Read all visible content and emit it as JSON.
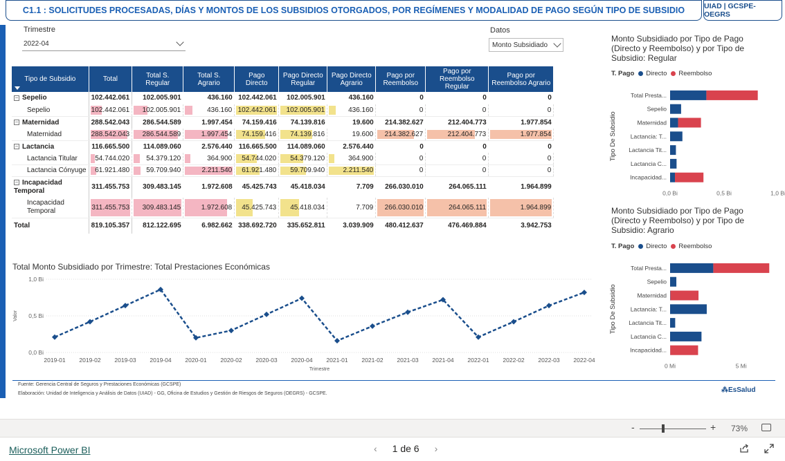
{
  "header": {
    "title": "C1.1 : SOLICITUDES PROCESADAS,  DÍAS Y MONTOS DE LOS SUBSIDIOS OTORGADOS, POR REGÍMENES Y MODALIDAD DE PAGO SEGÚN TIPO DE SUBSIDIO",
    "badge": "UIAD | GCSPE-OEGRS"
  },
  "slicers": {
    "trimestre_label": "Trimestre",
    "trimestre_value": "2022-04",
    "datos_label": "Datos",
    "datos_value": "Monto Subsidiado"
  },
  "matrix": {
    "headers": [
      "Tipo de Subsidio",
      "Total",
      "Total S. Regular",
      "Total S. Agrario",
      "Pago Directo",
      "Pago Directo Regular",
      "Pago Directo Agrario",
      "Pago por Reembolso",
      "Pago por Reembolso Regular",
      "Pago por Reembolso Agrario"
    ],
    "rows": [
      {
        "label": "Sepelio",
        "level": 0,
        "values": [
          "102.442.061",
          "102.005.901",
          "436.160",
          "102.442.061",
          "102.005.901",
          "436.160",
          "0",
          "0",
          "0"
        ]
      },
      {
        "label": "Sepelio",
        "level": 1,
        "values": [
          "102.442.061",
          "102.005.901",
          "436.160",
          "102.442.061",
          "102.005.901",
          "436.160",
          "0",
          "0",
          "0"
        ]
      },
      {
        "label": "Maternidad",
        "level": 0,
        "values": [
          "288.542.043",
          "286.544.589",
          "1.997.454",
          "74.159.416",
          "74.139.816",
          "19.600",
          "214.382.627",
          "212.404.773",
          "1.977.854"
        ]
      },
      {
        "label": "Maternidad",
        "level": 1,
        "values": [
          "288.542.043",
          "286.544.589",
          "1.997.454",
          "74.159.416",
          "74.139.816",
          "19.600",
          "214.382.627",
          "212.404.773",
          "1.977.854"
        ]
      },
      {
        "label": "Lactancia",
        "level": 0,
        "values": [
          "116.665.500",
          "114.089.060",
          "2.576.440",
          "116.665.500",
          "114.089.060",
          "2.576.440",
          "0",
          "0",
          "0"
        ]
      },
      {
        "label": "Lactancia Titular",
        "level": 1,
        "values": [
          "54.744.020",
          "54.379.120",
          "364.900",
          "54.744.020",
          "54.379.120",
          "364.900",
          "0",
          "0",
          "0"
        ]
      },
      {
        "label": "Lactancia Cónyuge",
        "level": 1,
        "values": [
          "61.921.480",
          "59.709.940",
          "2.211.540",
          "61.921.480",
          "59.709.940",
          "2.211.540",
          "0",
          "0",
          "0"
        ]
      },
      {
        "label": "Incapacidad Temporal",
        "level": 0,
        "values": [
          "311.455.753",
          "309.483.145",
          "1.972.608",
          "45.425.743",
          "45.418.034",
          "7.709",
          "266.030.010",
          "264.065.111",
          "1.964.899"
        ]
      },
      {
        "label": "Incapacidad Temporal",
        "level": 1,
        "values": [
          "311.455.753",
          "309.483.145",
          "1.972.608",
          "45.425.743",
          "45.418.034",
          "7.709",
          "266.030.010",
          "264.065.111",
          "1.964.899"
        ]
      }
    ],
    "total": {
      "label": "Total",
      "values": [
        "819.105.357",
        "812.122.695",
        "6.982.662",
        "338.692.720",
        "335.652.811",
        "3.039.909",
        "480.412.637",
        "476.469.884",
        "3.942.753"
      ]
    }
  },
  "bar_chart_regular": {
    "title": "Monto Subsidiado por Tipo de Pago (Directo y Reembolso) y por Tipo de Subsidio: Regular",
    "legend_title": "T. Pago",
    "legend_directo": "Directo",
    "legend_reembolso": "Reembolso",
    "ylabel": "Tipo De Subsidio",
    "xticks": [
      "0,0 Bi",
      "0,5 Bi",
      "1,0 Bi"
    ]
  },
  "bar_chart_agrario": {
    "title": "Monto Subsidiado por Tipo de Pago (Directo y Reembolso) y por Tipo de Subsidio: Agrario",
    "legend_title": "T. Pago",
    "legend_directo": "Directo",
    "legend_reembolso": "Reembolso",
    "ylabel": "Tipo De Subsidio",
    "xticks": [
      "0 Mi",
      "5 Mi"
    ]
  },
  "line_chart": {
    "title": "Total Monto Subsidiado por Trimestre: Total Prestaciones Económicas",
    "ylabel": "Valor",
    "xlabel": "Trimestre",
    "yticks": [
      "0,0 Bi",
      "0,5 Bi",
      "1,0 Bi"
    ]
  },
  "chart_data": [
    {
      "type": "bar",
      "orientation": "horizontal",
      "stacked": true,
      "title": "Monto Subsidiado por Tipo de Pago (Directo y Reembolso) y por Tipo de Subsidio: Regular",
      "categories": [
        "Total Presta...",
        "Sepelio",
        "Maternidad",
        "Lactancia: T...",
        "Lactancia Tit...",
        "Lactancia C...",
        "Incapacidad..."
      ],
      "series": [
        {
          "name": "Directo",
          "color": "#1a4e8c",
          "values": [
            0.336,
            0.102,
            0.074,
            0.114,
            0.054,
            0.06,
            0.045
          ]
        },
        {
          "name": "Reembolso",
          "color": "#d9434e",
          "values": [
            0.476,
            0,
            0.212,
            0,
            0,
            0,
            0.264
          ]
        }
      ],
      "xlabel": "",
      "ylabel": "Tipo De Subsidio",
      "xlim": [
        0,
        1.0
      ],
      "unit": "Bi"
    },
    {
      "type": "bar",
      "orientation": "horizontal",
      "stacked": true,
      "title": "Monto Subsidiado por Tipo de Pago (Directo y Reembolso) y por Tipo de Subsidio: Agrario",
      "categories": [
        "Total Presta...",
        "Sepelio",
        "Maternidad",
        "Lactancia: T...",
        "Lactancia Tit...",
        "Lactancia C...",
        "Incapacidad..."
      ],
      "series": [
        {
          "name": "Directo",
          "color": "#1a4e8c",
          "values": [
            3.04,
            0.44,
            0.02,
            2.58,
            0.36,
            2.21,
            0.01
          ]
        },
        {
          "name": "Reembolso",
          "color": "#d9434e",
          "values": [
            3.94,
            0,
            1.98,
            0,
            0,
            0,
            1.96
          ]
        }
      ],
      "xlabel": "",
      "ylabel": "Tipo De Subsidio",
      "xlim": [
        0,
        7.6
      ],
      "unit": "Mi"
    },
    {
      "type": "line",
      "title": "Total Monto Subsidiado por Trimestre: Total Prestaciones Económicas",
      "x": [
        "2019-01",
        "2019-02",
        "2019-03",
        "2019-04",
        "2020-01",
        "2020-02",
        "2020-03",
        "2020-04",
        "2021-01",
        "2021-02",
        "2021-03",
        "2021-04",
        "2022-01",
        "2022-02",
        "2022-03",
        "2022-04"
      ],
      "series": [
        {
          "color": "#1a4e8c",
          "values": [
            0.21,
            0.42,
            0.64,
            0.86,
            0.2,
            0.3,
            0.52,
            0.74,
            0.16,
            0.36,
            0.55,
            0.72,
            0.21,
            0.42,
            0.64,
            0.82
          ]
        }
      ],
      "xlabel": "Trimestre",
      "ylabel": "Valor",
      "ylim": [
        0,
        1.0
      ],
      "unit": "Bi",
      "style": "dashed"
    }
  ],
  "footer": {
    "fuente": "Fuente: Gerencia Central de Seguros y Prestaciones Económicas (GCSPE)",
    "elaboracion": "Elaboración: Unidad de Inteligencia y Análisis de Datos (UIAD) - GG, Oficina de Estudios y Gestión de Riesgos de Seguros (OEGRS) - GCSPE.",
    "logo": "EsSalud"
  },
  "zoom": {
    "minus": "-",
    "plus": "+",
    "percent": "73%"
  },
  "bottom": {
    "app_link": "Microsoft Power BI",
    "page_indicator": "1 de 6",
    "prev": "‹",
    "next": "›"
  },
  "colors": {
    "accent": "#1a5fb4",
    "header_blue": "#1a4e8c",
    "directo": "#1a4e8c",
    "reembolso": "#d9434e",
    "pink_bar": "#f4b6c2",
    "yellow_bar": "#f2e28c",
    "salmon_bar": "#f5c1a9"
  }
}
